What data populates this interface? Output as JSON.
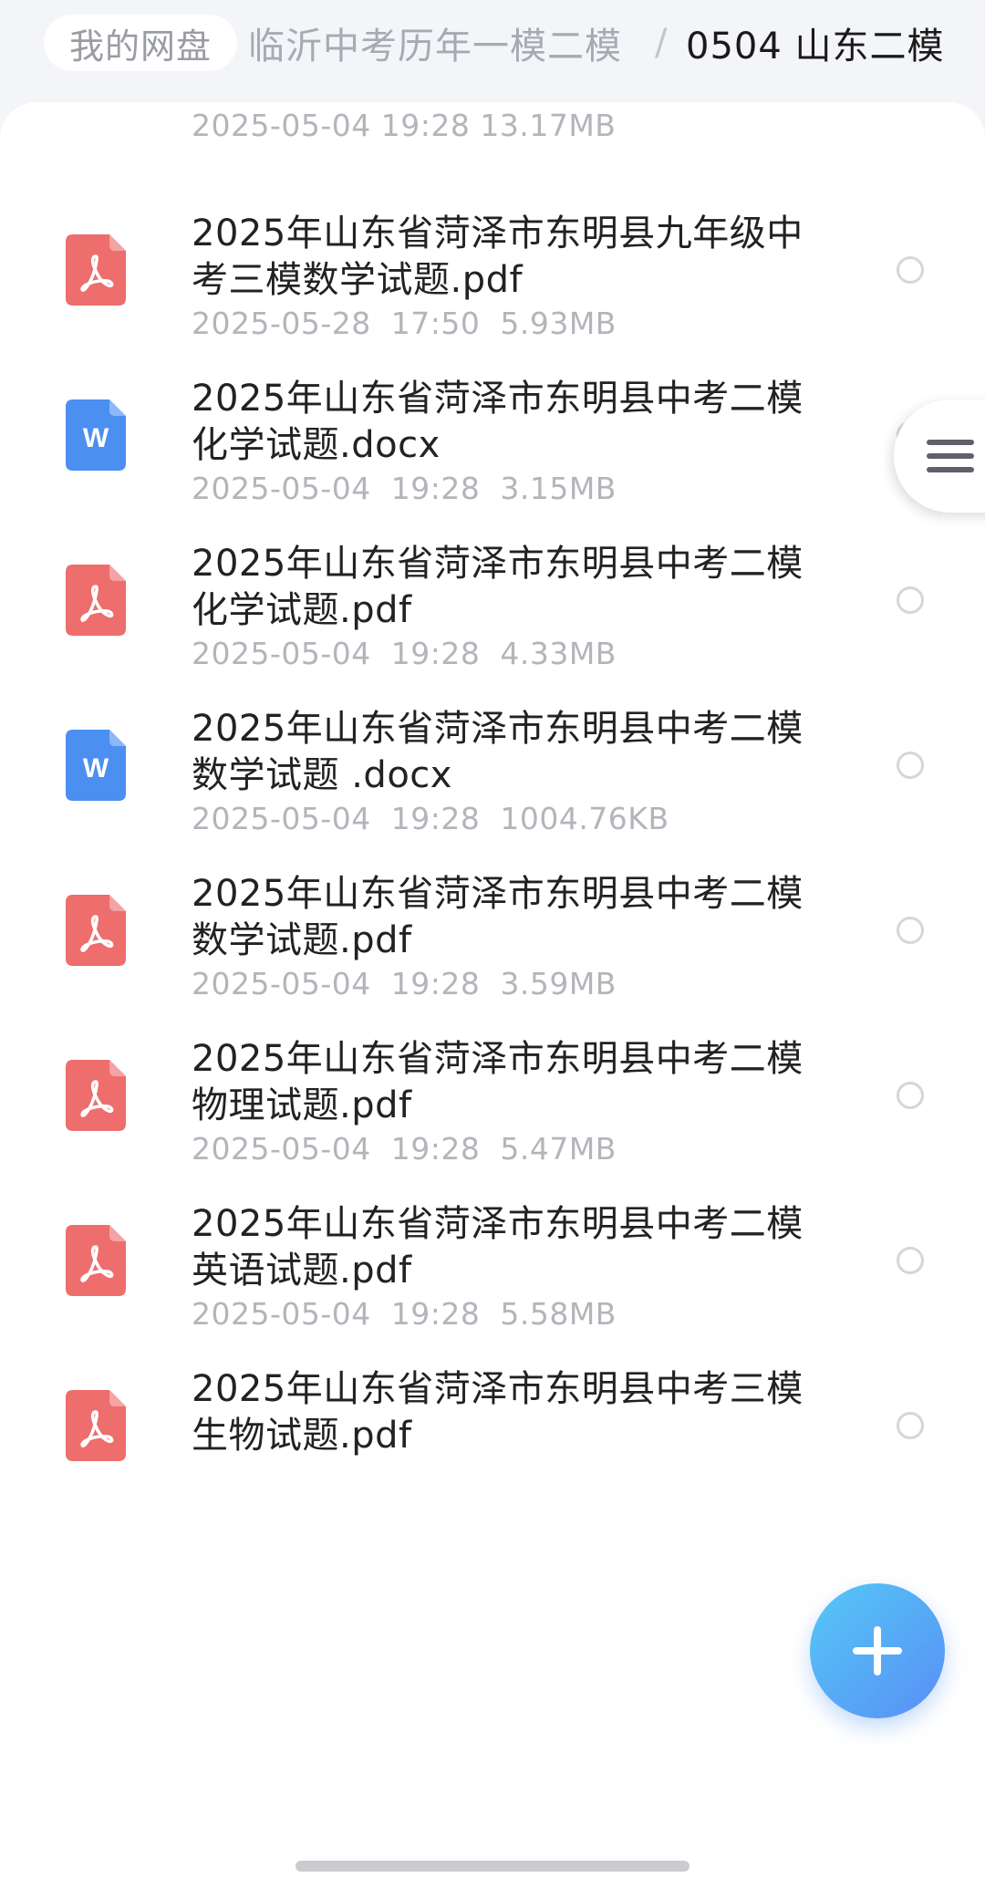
{
  "breadcrumb": {
    "root": "我的网盘",
    "parent": "临沂中考历年一模二模",
    "separator": "/",
    "current": "0504 山东二模"
  },
  "partial_row": {
    "meta": "2025-05-04  19:28  13.17MB"
  },
  "files": [
    {
      "type": "pdf",
      "name": "2025年山东省菏泽市东明县九年级中考三模数学试题.pdf",
      "meta": "2025-05-28  17:50  5.93MB"
    },
    {
      "type": "docx",
      "name": "2025年山东省菏泽市东明县中考二模化学试题.docx",
      "meta": "2025-05-04  19:28  3.15MB"
    },
    {
      "type": "pdf",
      "name": "2025年山东省菏泽市东明县中考二模化学试题.pdf",
      "meta": "2025-05-04  19:28  4.33MB"
    },
    {
      "type": "docx",
      "name": "2025年山东省菏泽市东明县中考二模数学试题 .docx",
      "meta": "2025-05-04  19:28  1004.76KB"
    },
    {
      "type": "pdf",
      "name": "2025年山东省菏泽市东明县中考二模数学试题.pdf",
      "meta": "2025-05-04  19:28  3.59MB"
    },
    {
      "type": "pdf",
      "name": "2025年山东省菏泽市东明县中考二模物理试题.pdf",
      "meta": "2025-05-04  19:28  5.47MB"
    },
    {
      "type": "pdf",
      "name": "2025年山东省菏泽市东明县中考二模英语试题.pdf",
      "meta": "2025-05-04  19:28  5.58MB"
    },
    {
      "type": "pdf",
      "name": "2025年山东省菏泽市东明县中考三模生物试题.pdf",
      "meta": ""
    }
  ],
  "icons": {
    "pdf": {
      "name": "pdf-file-icon",
      "color": "#ee6d6d"
    },
    "docx": {
      "name": "word-file-icon",
      "color": "#4b8ff0",
      "letter": "W"
    },
    "side_menu": "hamburger-menu-icon",
    "fab": "plus-icon"
  },
  "colors": {
    "accent_fab_start": "#54c9f6",
    "accent_fab_end": "#5a8ef6",
    "pdf_red": "#ee6d6d",
    "word_blue": "#4b8ff0"
  }
}
